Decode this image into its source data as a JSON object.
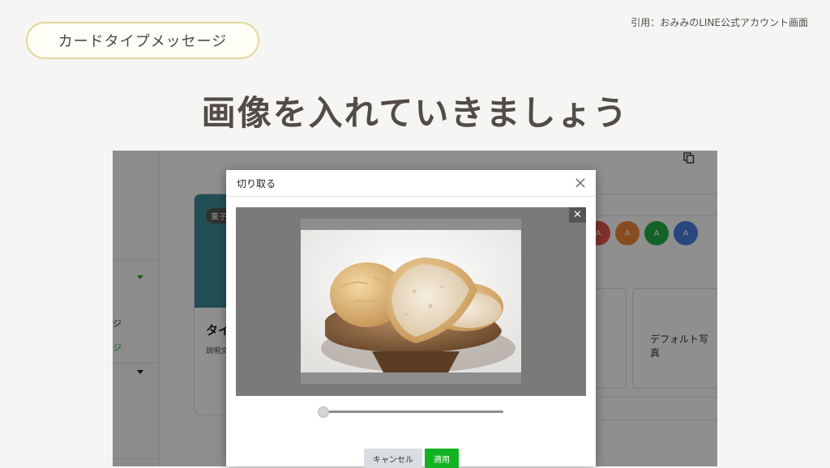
{
  "slide": {
    "pill_label": "カードタイプメッセージ",
    "citation": "引用：おみみのLINE公式アカウント画面",
    "headline": "画像を入れていきましょう"
  },
  "background_app": {
    "card_tag": "菓子",
    "card_title": "タイ",
    "card_desc": "説明文",
    "swatch_letters": [
      "A",
      "A",
      "A",
      "A"
    ],
    "swatch_colors": [
      "#e25a4b",
      "#f08a3c",
      "#22b04a",
      "#4a7fe0"
    ],
    "default_photo_label": "デフォルト写真",
    "sidebar_fragments": [
      "ジ",
      "ジ"
    ]
  },
  "modal": {
    "title": "切り取る",
    "cancel_label": "キャンセル",
    "apply_label": "適用",
    "zoom_level": 0
  },
  "colors": {
    "accent_green": "#12b322",
    "pill_border": "#e2d79a"
  },
  "icons": {
    "modal_close": "close-icon",
    "crop_close": "close-icon",
    "copy": "copy-icon"
  }
}
